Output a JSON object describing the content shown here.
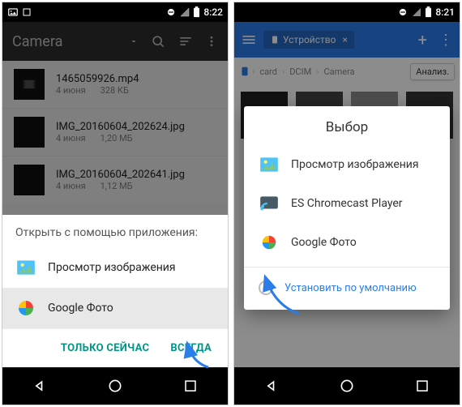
{
  "left": {
    "status": {
      "time": "8:22"
    },
    "toolbar": {
      "title": "Camera"
    },
    "files": [
      {
        "name": "1465059926.mp4",
        "date": "4 июня",
        "size": "328 КБ"
      },
      {
        "name": "IMG_20160604_202624.jpg",
        "date": "4 июня",
        "size": "1,20 МБ"
      },
      {
        "name": "IMG_20160604_202641.jpg",
        "date": "4 июня",
        "size": "1,12 МБ"
      }
    ],
    "chooser": {
      "title": "Открыть с помощью приложения:",
      "apps": [
        {
          "label": "Просмотр изображения"
        },
        {
          "label": "Google Фото"
        }
      ],
      "actions": {
        "once": "ТОЛЬКО СЕЙЧАС",
        "always": "ВСЕГДА"
      }
    }
  },
  "right": {
    "status": {
      "time": "8:21"
    },
    "tab": {
      "label": "Устройство"
    },
    "breadcrumb": {
      "items": [
        "card",
        "DCIM",
        "Camera"
      ],
      "analyze": "Анализ."
    },
    "dialog": {
      "title": "Выбор",
      "apps": [
        {
          "label": "Просмотр изображения"
        },
        {
          "label": "ES Chromecast Player"
        },
        {
          "label": "Google Фото"
        }
      ],
      "default_label": "Установить по умолчанию"
    }
  }
}
